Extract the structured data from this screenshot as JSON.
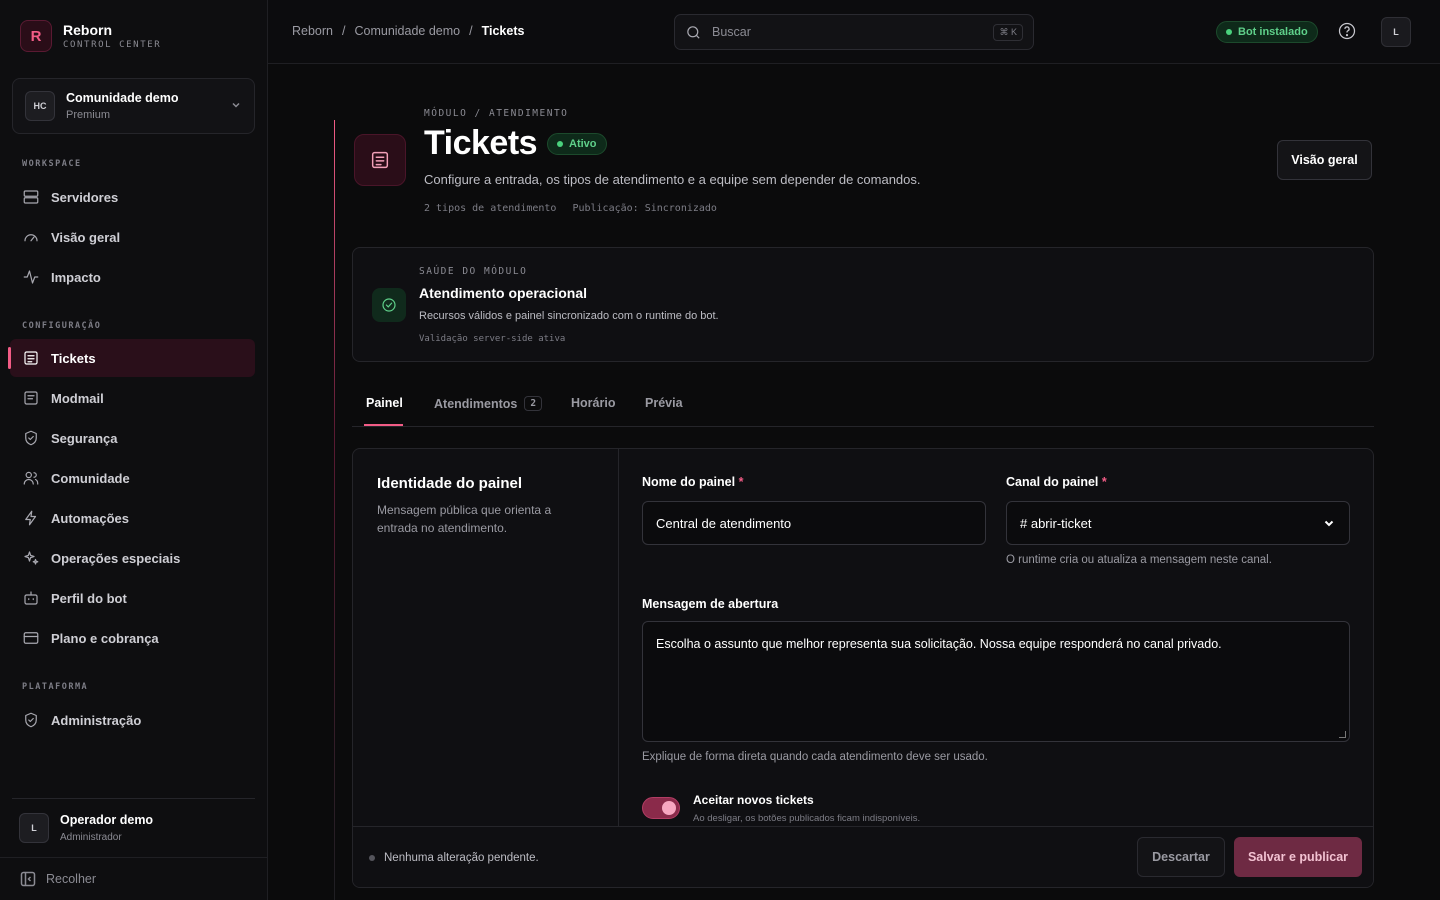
{
  "brand": {
    "logo_letter": "R",
    "name": "Reborn",
    "subtitle": "CONTROL CENTER"
  },
  "workspace": {
    "initials": "HC",
    "name": "Comunidade demo",
    "plan": "Premium"
  },
  "sidebar": {
    "sections": [
      {
        "label": "WORKSPACE",
        "items": [
          {
            "label": "Servidores",
            "icon": "server-icon"
          },
          {
            "label": "Visão geral",
            "icon": "gauge-icon"
          },
          {
            "label": "Impacto",
            "icon": "activity-icon"
          }
        ]
      },
      {
        "label": "CONFIGURAÇÃO",
        "items": [
          {
            "label": "Tickets",
            "icon": "ticket-icon",
            "active": true
          },
          {
            "label": "Modmail",
            "icon": "modmail-icon"
          },
          {
            "label": "Segurança",
            "icon": "shield-icon"
          },
          {
            "label": "Comunidade",
            "icon": "users-icon"
          },
          {
            "label": "Automações",
            "icon": "zap-icon"
          },
          {
            "label": "Operações especiais",
            "icon": "sparkles-icon"
          },
          {
            "label": "Perfil do bot",
            "icon": "bot-icon"
          },
          {
            "label": "Plano e cobrança",
            "icon": "credit-card-icon"
          }
        ]
      },
      {
        "label": "PLATAFORMA",
        "items": [
          {
            "label": "Administração",
            "icon": "shield-check-icon"
          }
        ]
      }
    ]
  },
  "user": {
    "initials": "L",
    "name": "Operador demo",
    "role": "Administrador"
  },
  "collapse_label": "Recolher",
  "topbar": {
    "breadcrumb": [
      "Reborn",
      "Comunidade demo",
      "Tickets"
    ],
    "search_placeholder": "Buscar",
    "search_shortcut": "⌘ K",
    "bot_status": "Bot instalado",
    "avatar_initials": "L"
  },
  "module": {
    "eyebrow": "MÓDULO / ATENDIMENTO",
    "title": "Tickets",
    "status": "Ativo",
    "description": "Configure a entrada, os tipos de atendimento e a equipe sem depender de comandos.",
    "meta_types": "2 tipos de atendimento",
    "meta_publish": "Publicação: Sincronizado",
    "overview_button": "Visão geral"
  },
  "health": {
    "label": "SAÚDE DO MÓDULO",
    "title": "Atendimento operacional",
    "description": "Recursos válidos e painel sincronizado com o runtime do bot.",
    "footer": "Validação server-side ativa"
  },
  "tabs": [
    {
      "label": "Painel",
      "active": true
    },
    {
      "label": "Atendimentos",
      "count": "2"
    },
    {
      "label": "Horário"
    },
    {
      "label": "Prévia"
    }
  ],
  "panel": {
    "title": "Identidade do painel",
    "description": "Mensagem pública que orienta a entrada no atendimento.",
    "name_label": "Nome do painel",
    "name_value": "Central de atendimento",
    "channel_label": "Canal do painel",
    "channel_value": "# abrir-ticket",
    "channel_hint": "O runtime cria ou atualiza a mensagem neste canal.",
    "message_label": "Mensagem de abertura",
    "message_value": "Escolha o assunto que melhor representa sua solicitação. Nossa equipe responderá no canal privado.",
    "message_hint": "Explique de forma direta quando cada atendimento deve ser usado.",
    "toggle_label": "Aceitar novos tickets",
    "toggle_hint": "Ao desligar, os botões publicados ficam indisponíveis.",
    "toggle_on": true,
    "required_mark": "*"
  },
  "savebar": {
    "status": "Nenhuma alteração pendente.",
    "discard": "Descartar",
    "publish": "Salvar e publicar"
  },
  "colors": {
    "accent": "#f25c86",
    "success": "#5fd08a",
    "background": "#0b0b0c"
  }
}
